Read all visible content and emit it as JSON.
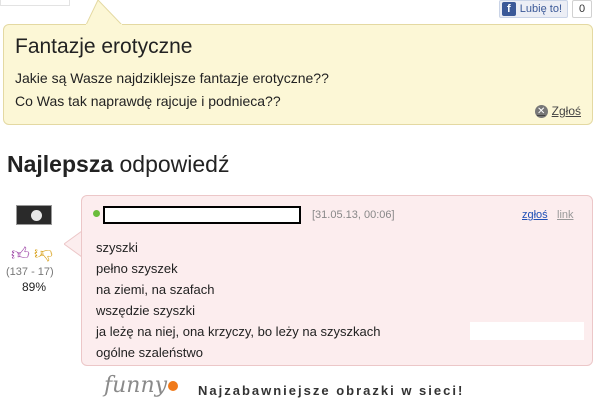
{
  "like": {
    "label": "Lubię to!",
    "count": "0"
  },
  "question": {
    "title": "Fantazje erotyczne",
    "lines": [
      "Jakie są Wasze najdziklejsze fantazje erotyczne??",
      "Co Was tak naprawdę rajcuje i podnieca??"
    ],
    "report_label": "Zgłoś"
  },
  "best_answer": {
    "heading_bold": "Najlepsza",
    "heading_rest": " odpowiedź"
  },
  "votes": {
    "counts": "(137 - 17)",
    "percent": "89%"
  },
  "answer": {
    "date": "[31.05.13, 00:06]",
    "report_label": "zgłoś",
    "link_label": "link",
    "lines": [
      "szyszki",
      "pełno szyszek",
      "na ziemi, na szafach",
      "wszędzie szyszki",
      "ja leżę na niej, ona krzyczy, bo leży na szyszkach",
      "ogólne szaleństwo"
    ]
  },
  "footer": {
    "logo_text": "funny",
    "tagline": "Najzabawniejsze obrazki w sieci!"
  },
  "colors": {
    "question_bg": "#fcf7d6",
    "answer_bg": "#fcedee",
    "link_blue": "#1e4fb6",
    "online_green": "#6abd3b",
    "logo_orange": "#f07a1a"
  }
}
